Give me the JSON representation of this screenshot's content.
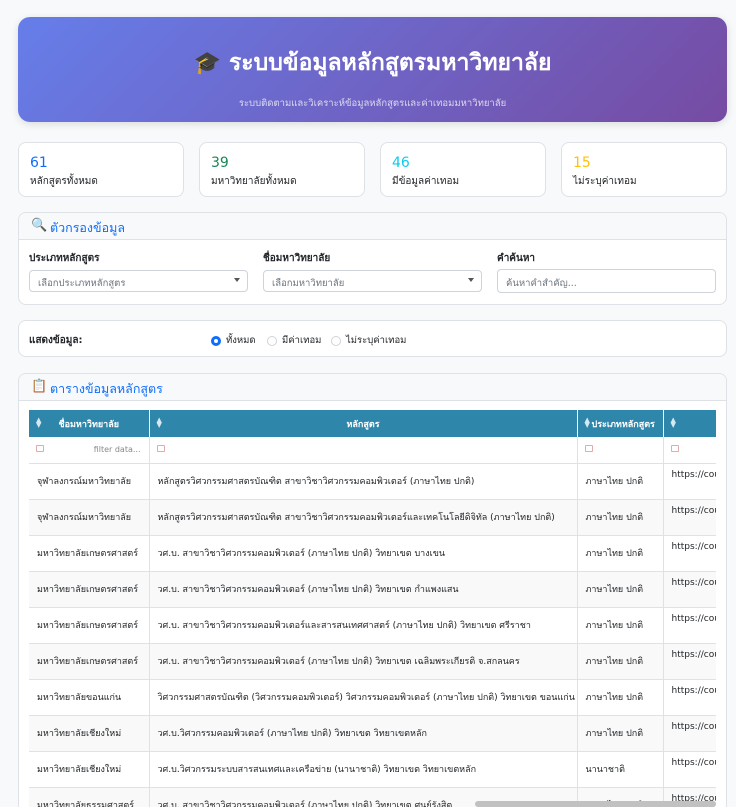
{
  "header": {
    "icon": "graduation-cap-icon",
    "title": "ระบบข้อมูลหลักสูตรมหาวิทยาลัย",
    "subtitle": "ระบบติดตามและวิเคราะห์ข้อมูลหลักสูตรและค่าเทอมมหาวิทยาลัย"
  },
  "stats": [
    {
      "value": "61",
      "label": "หลักสูตรทั้งหมด",
      "color": "#0d6efd"
    },
    {
      "value": "39",
      "label": "มหาวิทยาลัยทั้งหมด",
      "color": "#198754"
    },
    {
      "value": "46",
      "label": "มีข้อมูลค่าเทอม",
      "color": "#0dcaf0"
    },
    {
      "value": "15",
      "label": "ไม่ระบุค่าเทอม",
      "color": "#ffc107"
    }
  ],
  "filters": {
    "title": "ตัวกรองข้อมูล",
    "icon": "magnifier-icon",
    "program_type_label": "ประเภทหลักสูตร",
    "program_type_placeholder": "เลือกประเภทหลักสูตร",
    "university_label": "ชื่อมหาวิทยาลัย",
    "university_placeholder": "เลือกมหาวิทยาลัย",
    "search_label": "คำค้นหา",
    "search_placeholder": "ค้นหาคำสำคัญ..."
  },
  "display": {
    "label": "แสดงข้อมูล:",
    "options": [
      "ทั้งหมด",
      "มีค่าเทอม",
      "ไม่ระบุค่าเทอม"
    ],
    "selected": "ทั้งหมด"
  },
  "table": {
    "title": "ตารางข้อมูลหลักสูตร",
    "icon": "clipboard-icon",
    "columns": [
      "ชื่อมหาวิทยาลัย",
      "หลักสูตร",
      "ประเภทหลักสูตร",
      ""
    ],
    "filter_placeholder": "filter data...",
    "rows": [
      [
        "จุฬาลงกรณ์มหาวิทยาลัย",
        "หลักสูตรวิศวกรรมศาสตรบัณฑิต สาขาวิชาวิศวกรรมคอมพิวเตอร์ (ภาษาไทย ปกติ)",
        "ภาษาไทย ปกติ",
        "https://cours"
      ],
      [
        "จุฬาลงกรณ์มหาวิทยาลัย",
        "หลักสูตรวิศวกรรมศาสตรบัณฑิต สาขาวิชาวิศวกรรมคอมพิวเตอร์และเทคโนโลยีดิจิทัล (ภาษาไทย ปกติ)",
        "ภาษาไทย ปกติ",
        "https://cours"
      ],
      [
        "มหาวิทยาลัยเกษตรศาสตร์",
        "วศ.บ. สาขาวิชาวิศวกรรมคอมพิวเตอร์ (ภาษาไทย ปกติ) วิทยาเขต บางเขน",
        "ภาษาไทย ปกติ",
        "https://cours"
      ],
      [
        "มหาวิทยาลัยเกษตรศาสตร์",
        "วศ.บ. สาขาวิชาวิศวกรรมคอมพิวเตอร์ (ภาษาไทย ปกติ) วิทยาเขต กำแพงแสน",
        "ภาษาไทย ปกติ",
        "https://cours"
      ],
      [
        "มหาวิทยาลัยเกษตรศาสตร์",
        "วศ.บ. สาขาวิชาวิศวกรรมคอมพิวเตอร์และสารสนเทศศาสตร์ (ภาษาไทย ปกติ) วิทยาเขต ศรีราชา",
        "ภาษาไทย ปกติ",
        "https://cours"
      ],
      [
        "มหาวิทยาลัยเกษตรศาสตร์",
        "วศ.บ. สาขาวิชาวิศวกรรมคอมพิวเตอร์ (ภาษาไทย ปกติ) วิทยาเขต เฉลิมพระเกียรติ จ.สกลนคร",
        "ภาษาไทย ปกติ",
        "https://cours"
      ],
      [
        "มหาวิทยาลัยขอนแก่น",
        "วิศวกรรมศาสตรบัณฑิต (วิศวกรรมคอมพิวเตอร์) วิศวกรรมคอมพิวเตอร์ (ภาษาไทย ปกติ) วิทยาเขต ขอนแก่น",
        "ภาษาไทย ปกติ",
        "https://cours"
      ],
      [
        "มหาวิทยาลัยเชียงใหม่",
        "วศ.บ.วิศวกรรมคอมพิวเตอร์ (ภาษาไทย ปกติ) วิทยาเขต วิทยาเขตหลัก",
        "ภาษาไทย ปกติ",
        "https://cours"
      ],
      [
        "มหาวิทยาลัยเชียงใหม่",
        "วศ.บ.วิศวกรรมระบบสารสนเทศและเครือข่าย (นานาชาติ) วิทยาเขต วิทยาเขตหลัก",
        "นานาชาติ",
        "https://cours"
      ],
      [
        "มหาวิทยาลัยธรรมศาสตร์",
        "วศ.บ. สาขาวิชาวิศวกรรมคอมพิวเตอร์ (ภาษาไทย ปกติ) วิทยาเขต ศูนย์รังสิต",
        "ภาษาไทย ปกติ",
        "https://cours"
      ]
    ]
  }
}
